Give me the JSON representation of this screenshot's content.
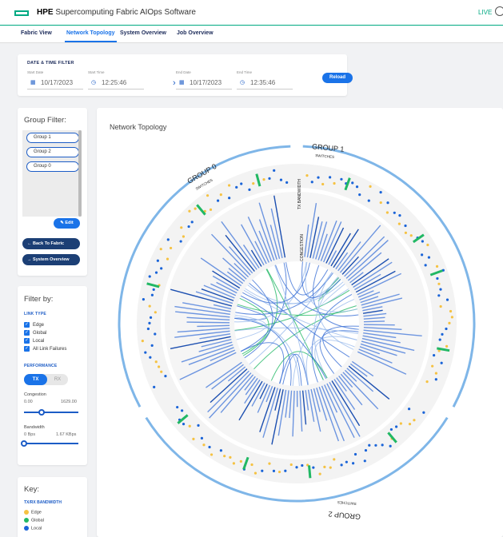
{
  "header": {
    "brand_bold": "HPE",
    "brand_rest": " Supercomputing Fabric AIOps Software",
    "live": "LIVE"
  },
  "tabs": [
    {
      "label": "Fabric View"
    },
    {
      "label": "Network Topology"
    },
    {
      "label": "System Overview"
    },
    {
      "label": "Job Overview"
    }
  ],
  "datetime": {
    "title": "DATE & TIME FILTER",
    "start_date_label": "Start Date",
    "start_date": "10/17/2023",
    "start_time_label": "Start Time",
    "start_time": "12:25:46",
    "end_date_label": "End Date",
    "end_date": "10/17/2023",
    "end_time_label": "End Time",
    "end_time": "12:35:46",
    "reload": "Reload"
  },
  "group_filter": {
    "title": "Group Filter:",
    "groups": [
      "Group 1",
      "Group 2",
      "Group 0"
    ],
    "edit": "✎ Edit",
    "back": "← Back To Fabric",
    "overview": "→ System Overview"
  },
  "filter_by": {
    "title": "Filter by:",
    "link_type_label": "LINK TYPE",
    "link_types": [
      "Edge",
      "Global",
      "Local",
      "All Link Failures"
    ],
    "performance_label": "PERFORMANCE",
    "tx": "TX",
    "rx": "RX",
    "congestion_label": "Congestion",
    "congestion_min": "0.00",
    "congestion_max": "1629.00",
    "congestion_value": 0.33,
    "bandwidth_label": "Bandwidth",
    "bandwidth_min": "0 Bps",
    "bandwidth_max": "1.67 KBps",
    "bandwidth_value": 0.0
  },
  "key": {
    "title": "Key:",
    "section": "TX/RX BANDWIDTH",
    "items": [
      {
        "label": "Edge",
        "color": "#f5c242"
      },
      {
        "label": "Global",
        "color": "#21b864"
      },
      {
        "label": "Local",
        "color": "#1a64d8"
      }
    ]
  },
  "topology": {
    "title": "Network Topology",
    "group_labels": [
      "GROUP 1",
      "GROUP 2",
      "GROUP 0"
    ],
    "switches_label": "SWITCHES",
    "tx_bandwidth_label": "TX BANDWIDTH",
    "congestion_label": "CONGESTION",
    "colors": {
      "edge": "#f5c242",
      "global": "#21b864",
      "local": "#1a64d8",
      "arc": "#7fb6e8"
    }
  }
}
